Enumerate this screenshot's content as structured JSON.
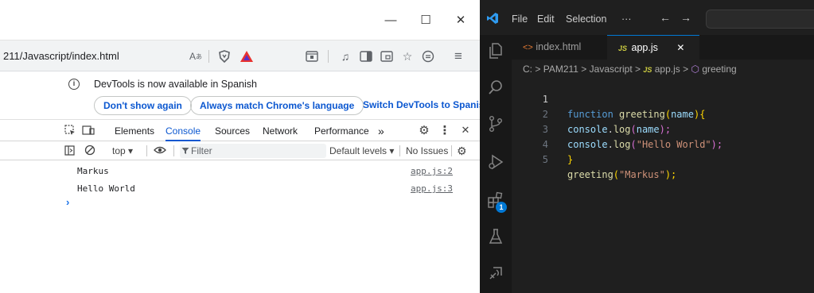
{
  "browser": {
    "url": "211/Javascript/index.html",
    "window_controls": {
      "minimize": "—",
      "maximize": "☐",
      "close": "✕"
    },
    "notice": {
      "text": "DevTools is now available in Spanish",
      "buttons": [
        "Don't show again",
        "Always match Chrome's language",
        "Switch DevTools to Spanish"
      ]
    },
    "devtools": {
      "tabs": [
        "Elements",
        "Console",
        "Sources",
        "Network",
        "Performance"
      ],
      "active_tab": "Console",
      "more_tabs": "»",
      "toolbar": {
        "context": "top ▾",
        "filter_placeholder": "Filter",
        "levels": "Default levels ▾",
        "issues": "No Issues"
      },
      "logs": [
        {
          "text": "Markus",
          "source": "app.js:2"
        },
        {
          "text": "Hello World",
          "source": "app.js:3"
        }
      ],
      "prompt": "›"
    }
  },
  "vscode": {
    "menu": [
      "File",
      "Edit",
      "Selection",
      "···"
    ],
    "nav": {
      "back": "←",
      "forward": "→"
    },
    "tabs": [
      {
        "label": "index.html",
        "icon": "html-icon",
        "active": false
      },
      {
        "label": "app.js",
        "icon": "js-icon",
        "active": true,
        "close": "✕"
      }
    ],
    "breadcrumbs": {
      "drive": "C:",
      "sep": ">",
      "folder1": "PAM211",
      "folder2": "Javascript",
      "file": "app.js",
      "symbol": "greeting",
      "js_badge": "JS"
    },
    "badge_count": "1",
    "code": {
      "line_numbers": [
        "1",
        "2",
        "3",
        "4",
        "5"
      ],
      "l1_kw": "function",
      "l1_fn": "greeting",
      "l1_open": "(",
      "l1_param": "name",
      "l1_close": ")",
      "l1_brace": "{",
      "l2_obj": "console",
      "l2_dot": ".",
      "l2_fn": "log",
      "l2_open": "(",
      "l2_arg": "name",
      "l2_close": ");",
      "l3_obj": "console",
      "l3_dot": ".",
      "l3_fn": "log",
      "l3_open": "(",
      "l3_str": "\"Hello World\"",
      "l3_close": ");",
      "l4_brace": "}",
      "l5_fn": "greeting",
      "l5_open": "(",
      "l5_str": "\"Markus\"",
      "l5_close": ");"
    }
  },
  "colors": {
    "devtools_accent": "#0b57d0",
    "vscode_bg": "#1f1f1f",
    "vscode_activity": "#181818",
    "vscode_accent": "#0078d4"
  }
}
